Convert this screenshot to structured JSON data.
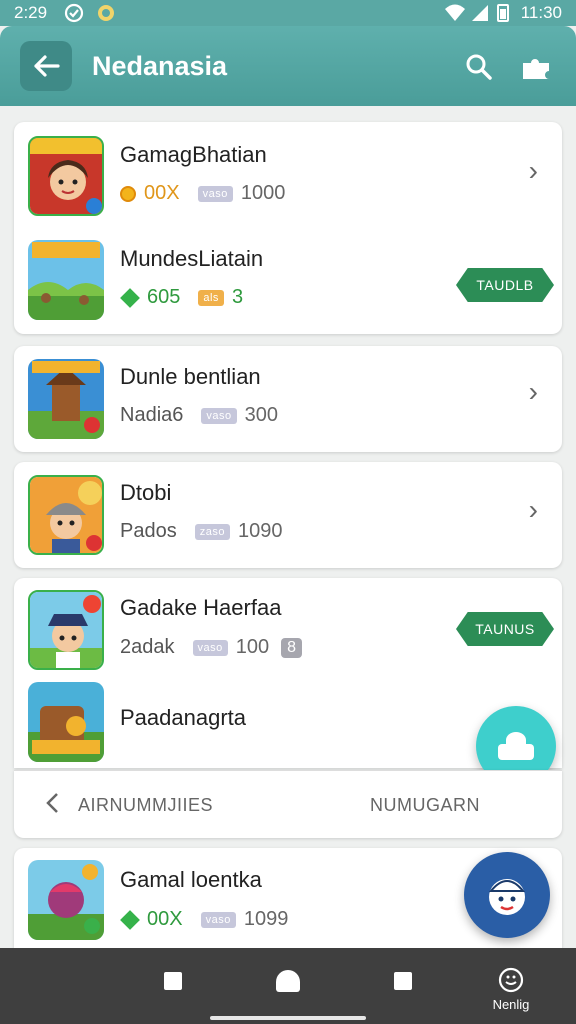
{
  "status_bar": {
    "time": "2:29",
    "clock": "11:30"
  },
  "app_bar": {
    "title": "Nedanasia"
  },
  "games": [
    {
      "title": "GamagBhatian",
      "value": "00X",
      "tag": "vaso",
      "count": "1000"
    },
    {
      "title": "MundesLiatain",
      "value": "605",
      "tag": "als",
      "count": "3",
      "action": "TAUDLB"
    },
    {
      "title": "Dunle bentlian",
      "value": "Nadia6",
      "tag": "vaso",
      "count": "300"
    },
    {
      "title": "Dtobi",
      "value": "Pados",
      "tag": "zaso",
      "count": "1090"
    },
    {
      "title": "Gadake Haerfaa",
      "value": "2adak",
      "tag": "vaso",
      "count": "100",
      "badge": "8",
      "action": "TAUNUS"
    },
    {
      "title": "Paadanagrta"
    },
    {
      "title": "Gamal loentka",
      "value": "00X",
      "tag": "vaso",
      "count": "1099"
    }
  ],
  "pager": {
    "prev_label": "AIRNUMMJIIES",
    "next_label": "NUMUGARN"
  },
  "nav_bar": {
    "more_label": "Nenlig"
  },
  "colors": {
    "accent": "#4a9d99",
    "action_green": "#2c8d56",
    "fab_teal": "#3ecfcc",
    "fab_blue": "#2a5ea6"
  }
}
